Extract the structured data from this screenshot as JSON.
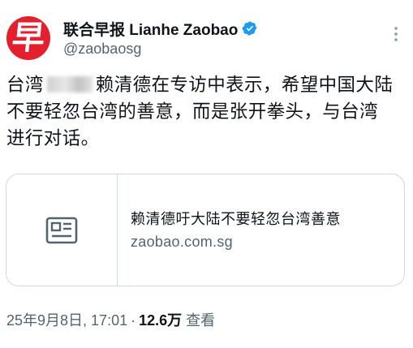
{
  "author": {
    "display_name": "联合早报 Lianhe Zaobao",
    "handle": "@zaobaosg",
    "avatar_glyph": "早",
    "avatar_color": "#e3202e",
    "verified": true,
    "verified_color": "#1d9bf0"
  },
  "tweet": {
    "text_part1": "台湾",
    "text_part2": "赖清德在专访中表示，希望中国大陆不要轻忽台湾的善意，而是张开拳头，与台湾进行对话。"
  },
  "link_card": {
    "icon": "article-icon",
    "title": "赖清德吁大陆不要轻忽台湾善意",
    "domain": "zaobao.com.sg"
  },
  "meta": {
    "timestamp": "25年9月8日, 17:01",
    "separator": "·",
    "views_count": "12.6万",
    "views_label": "查看"
  }
}
